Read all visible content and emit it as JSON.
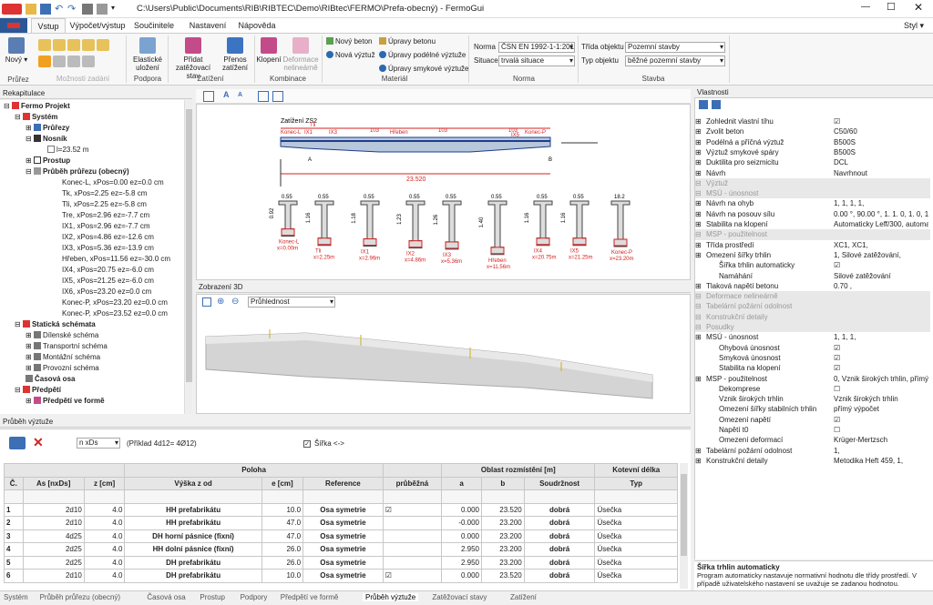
{
  "title_bar": {
    "path": "C:\\Users\\Public\\Documents\\RIB\\RIBTEC\\Demo\\RIBtec\\FERMO\\Prefa-obecný) - FermoGui"
  },
  "ribbon_tabs": [
    "Vstup",
    "Výpočet/výstup",
    "Součinitele",
    "Nastavení",
    "Nápověda"
  ],
  "style_label": "Styl",
  "ribbon": {
    "new_label": "Nový",
    "profile_group": "Průřez",
    "possible_input": "Možnosti zadání",
    "support_label": "Elastické uložení",
    "support_group": "Podpora",
    "add_load_label": "Přidat zatěžovací stav",
    "transfer_label": "Přenos zatížení",
    "load_group": "Zatížení",
    "bend_label": "Klopení",
    "deform_label": "Deformace nelineárně",
    "combo_group": "Kombinace",
    "new_concrete": "Nový beton",
    "new_rebar": "Nová výztuž",
    "edit_concrete": "Úpravy betonu",
    "edit_long": "Úpravy podélné výztuže",
    "edit_shear": "Úpravy smykové výztuže",
    "material_group": "Materiál",
    "norm_label": "Norma",
    "norm_value": "ČSN EN 1992-1-1:201",
    "situation_label": "Situace",
    "situation_value": "trvalá situace",
    "norm_group": "Norma",
    "class_label": "Třída objektu",
    "class_value": "Pozemní stavby",
    "type_label": "Typ objektu",
    "type_value": "běžné pozemní stavby",
    "building_group": "Stavba"
  },
  "recap": {
    "title": "Rekapitulace",
    "items": [
      "Fermo Projekt",
      "Systém",
      "Průřezy",
      "Nosník",
      "l=23.52 m",
      "Prostup",
      "Průběh průřezu (obecný)",
      "Konec-L, xPos=0.00 ez=0.0 cm",
      "Tk, xPos=2.25 ez=-5.8 cm",
      "Tli, xPos=2.25 ez=-5.8 cm",
      "Tre, xPos=2.96 ez=-7.7 cm",
      "IX1, xPos=2.96 ez=-7.7 cm",
      "IX2, xPos=4.86 ez=-12.6 cm",
      "IX3, xPos=5.36 ez=-13.9 cm",
      "Hřeben, xPos=11.56 ez=-30.0 cm",
      "IX4, xPos=20.75 ez=-6.0 cm",
      "IX5, xPos=21.25 ez=-6.0 cm",
      "IX6, xPos=23.20 ez=0.0 cm",
      "Konec-P, xPos=23.20 ez=0.0 cm",
      "Konec-P, xPos=23.52 ez=0.0 cm",
      "Statická schémata",
      "Dílenské schéma",
      "Transportní schéma",
      "Montážní schéma",
      "Provozní schéma",
      "Časová osa",
      "Předpětí",
      "Předpětí ve formě"
    ]
  },
  "view2d": {
    "load": "Zatížení ZS2",
    "len": "23.520",
    "sections": [
      {
        "w": "0.55",
        "h": "0.92",
        "n": "Konec-L",
        "x": "x=0.00m"
      },
      {
        "w": "0.55",
        "h": "1.16",
        "n": "Tli",
        "x": "x=2.25m"
      },
      {
        "w": "0.55",
        "h": "1.18",
        "n": "IX1",
        "x": "x=2.96m"
      },
      {
        "w": "0.55",
        "h": "1.23",
        "n": "IX2",
        "x": "x=4.86m"
      },
      {
        "w": "0.55",
        "h": "1.26",
        "n": "IX3",
        "x": "x=5.36m"
      },
      {
        "w": "0.55",
        "h": "1.40",
        "n": "Hřeben",
        "x": "x=11.56m"
      },
      {
        "w": "0.55",
        "h": "1.16",
        "n": "IX4",
        "x": "x=20.75m"
      },
      {
        "w": "0.55",
        "h": "1.16",
        "n": "IX5",
        "x": "x=21.25m"
      },
      {
        "w": "18.2",
        "h": "",
        "n": "Konec-P",
        "x": "x=23.20m"
      }
    ],
    "beam_labels": [
      "Konec-L",
      "Tli",
      "IX1",
      "IX3",
      "Hřeben",
      "103",
      "103",
      "103",
      "IX5",
      "Konec-P"
    ]
  },
  "view3d": {
    "title": "Zobrazení 3D",
    "transparency": "Průhlednost"
  },
  "props": {
    "title": "Vlastnosti",
    "rows": [
      {
        "k": "Zohlednit vlastní tíhu",
        "v": "☑",
        "t": "r"
      },
      {
        "k": "Zvolit beton",
        "v": "C50/60",
        "t": "r"
      },
      {
        "k": "Podélná a příčná výztuž",
        "v": "B500S",
        "t": "r"
      },
      {
        "k": "Výztuž smykové spáry",
        "v": "B500S",
        "t": "r"
      },
      {
        "k": "Duktilita pro seizmicitu",
        "v": "DCL",
        "t": "r"
      },
      {
        "k": "Návrh",
        "v": "Navrhnout",
        "t": "r"
      },
      {
        "k": "Výztuž",
        "v": "",
        "t": "c"
      },
      {
        "k": "MSÚ - únosnost",
        "v": "",
        "t": "c"
      },
      {
        "k": "Návrh na ohyb",
        "v": "1, 1, 1, 1,",
        "t": "r"
      },
      {
        "k": "Návrh na posouv sílu",
        "v": "0.00 °, 90.00 °, 1. 1. 0, 1. 0, 1,",
        "t": "r"
      },
      {
        "k": "Stabilita na klopení",
        "v": "Automaticky Leff/300, automati...",
        "t": "r"
      },
      {
        "k": "MSP - použitelnost",
        "v": "",
        "t": "c"
      },
      {
        "k": "Třída prostředí",
        "v": "XC1, XC1,",
        "t": "r"
      },
      {
        "k": "Omezení šířky trhlin",
        "v": "1, Silové zatěžování,",
        "t": "r"
      },
      {
        "k": "Šířka trhlin automaticky",
        "v": "☑",
        "t": "s"
      },
      {
        "k": "Namáhání",
        "v": "Silové zatěžování",
        "t": "s"
      },
      {
        "k": "Tlaková napětí betonu",
        "v": "0.70 ,",
        "t": "r"
      },
      {
        "k": "Deformace nelineárně",
        "v": "",
        "t": "c"
      },
      {
        "k": "Tabelární požární odolnost",
        "v": "",
        "t": "c"
      },
      {
        "k": "Konstrukční detaily",
        "v": "",
        "t": "c"
      },
      {
        "k": "Posudky",
        "v": "",
        "t": "c"
      },
      {
        "k": "MSÚ - únosnost",
        "v": "1, 1, 1,",
        "t": "r"
      },
      {
        "k": "Ohybová únosnost",
        "v": "☑",
        "t": "s"
      },
      {
        "k": "Smyková únosnost",
        "v": "☑",
        "t": "s"
      },
      {
        "k": "Stabilita na klopení",
        "v": "☑",
        "t": "s"
      },
      {
        "k": "MSP - použitelnost",
        "v": "0, Vznik širokých trhlin, přímý v...",
        "t": "r"
      },
      {
        "k": "Dekomprese",
        "v": "☐",
        "t": "s"
      },
      {
        "k": "Vznik širokých trhlin",
        "v": "Vznik širokých trhlin",
        "t": "s"
      },
      {
        "k": "Omezení šířky stabilních trhlin",
        "v": "přímý výpočet",
        "t": "s"
      },
      {
        "k": "Omezení napětí",
        "v": "☑",
        "t": "s"
      },
      {
        "k": "Napětí t0",
        "v": "☐",
        "t": "s"
      },
      {
        "k": "Omezení deformací",
        "v": "Krüger-Mertzsch",
        "t": "s"
      },
      {
        "k": "Tabelární požární odolnost",
        "v": "1,",
        "t": "r"
      },
      {
        "k": "Konstrukční detaily",
        "v": "Metodika Heft 459, 1,",
        "t": "r"
      }
    ],
    "help_title": "Šířka trhlin automaticky",
    "help_text": "Program automaticky nastavuje normativní hodnotu dle třídy prostředí. V případě uživatelského nastavení se uvažuje se zadanou hodnotou."
  },
  "rebar": {
    "title": "Průběh výztuže",
    "count_select": "n xDs",
    "example": "(Příklad 4d12= 4Ø12)",
    "width_label": "Šířka <->",
    "group_headers": [
      "Poloha",
      "Oblast rozmístění [m]",
      "Kotevní délka"
    ],
    "headers": [
      "Č.",
      "As [nxDs]",
      "z [cm]",
      "Výška z od",
      "e [cm]",
      "Reference",
      "průběžná",
      "a",
      "b",
      "Soudržnost",
      "Typ"
    ],
    "rows": [
      [
        "1",
        "2d10",
        "4.0",
        "HH prefabrikátu",
        "10.0",
        "Osa symetrie",
        "☑",
        "0.000",
        "23.520",
        "dobrá",
        "Úsečka"
      ],
      [
        "2",
        "2d10",
        "4.0",
        "HH prefabrikátu",
        "47.0",
        "Osa symetrie",
        "",
        "-0.000",
        "23.200",
        "dobrá",
        "Úsečka"
      ],
      [
        "3",
        "4d25",
        "4.0",
        "DH horní pásnice (fixní)",
        "47.0",
        "Osa symetrie",
        "",
        "0.000",
        "23.200",
        "dobrá",
        "Úsečka"
      ],
      [
        "4",
        "2d25",
        "4.0",
        "HH dolní pásnice (fixní)",
        "26.0",
        "Osa symetrie",
        "",
        "2.950",
        "23.200",
        "dobrá",
        "Úsečka"
      ],
      [
        "5",
        "2d25",
        "4.0",
        "DH prefabrikátu",
        "26.0",
        "Osa symetrie",
        "",
        "2.950",
        "23.200",
        "dobrá",
        "Úsečka"
      ],
      [
        "6",
        "2d10",
        "4.0",
        "DH prefabrikátu",
        "10.0",
        "Osa symetrie",
        "☑",
        "0.000",
        "23.520",
        "dobrá",
        "Úsečka"
      ]
    ]
  },
  "status_tabs": [
    "Systém",
    "Průběh průřezu (obecný)",
    "Časová osa",
    "Prostup",
    "Podpory",
    "Předpětí ve formě",
    "Průběh výztuže",
    "Zatěžovací stavy",
    "Zatížení"
  ],
  "colors": {
    "accent": "#1e5fa8",
    "red": "#d42020",
    "beam": "#b8c8dc"
  }
}
